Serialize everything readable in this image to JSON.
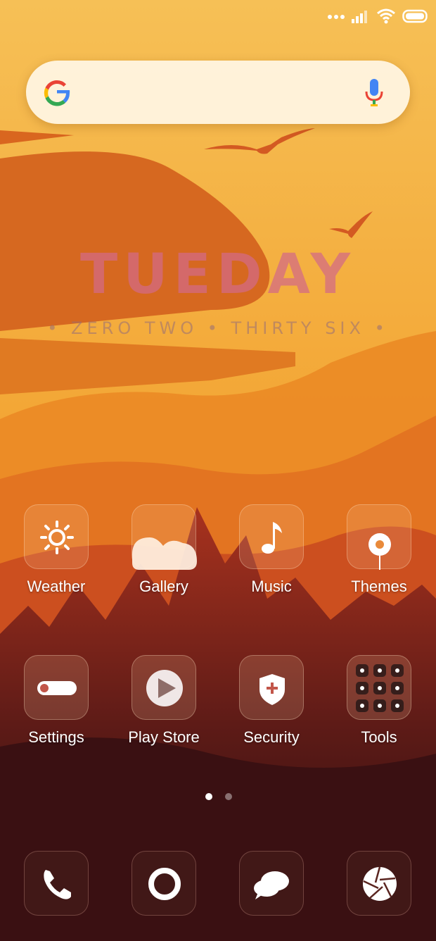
{
  "status_bar": {
    "icons": [
      "dots-icon",
      "cellular-signal-icon",
      "wifi-icon",
      "battery-icon"
    ]
  },
  "search": {
    "logo": "google-logo",
    "mic_icon": "mic-icon"
  },
  "clock_widget": {
    "day": "TUEDAY",
    "time": "• ZERO TWO • THIRTY SIX •"
  },
  "apps_row1": [
    {
      "label": "Weather",
      "icon": "sun-icon"
    },
    {
      "label": "Gallery",
      "icon": "cloud-icon"
    },
    {
      "label": "Music",
      "icon": "music-note-icon"
    },
    {
      "label": "Themes",
      "icon": "flower-icon"
    }
  ],
  "apps_row2": [
    {
      "label": "Settings",
      "icon": "toggle-icon"
    },
    {
      "label": "Play Store",
      "icon": "play-icon"
    },
    {
      "label": "Security",
      "icon": "shield-icon"
    },
    {
      "label": "Tools",
      "icon": "tools-grid-icon"
    }
  ],
  "page_indicator": {
    "pages": 2,
    "current": 1
  },
  "dock": [
    {
      "icon": "phone-icon"
    },
    {
      "icon": "circle-icon"
    },
    {
      "icon": "chat-bubble-icon"
    },
    {
      "icon": "camera-aperture-icon"
    }
  ]
}
